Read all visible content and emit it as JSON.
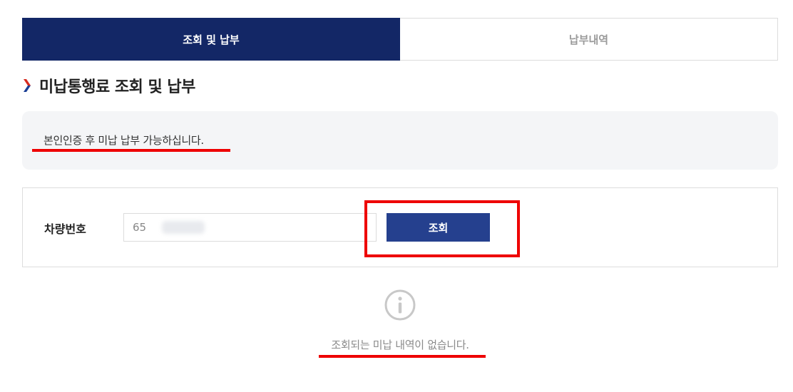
{
  "tabs": [
    {
      "label": "조회 및 납부",
      "active": true
    },
    {
      "label": "납부내역",
      "active": false
    }
  ],
  "section": {
    "title": "미납통행료 조회 및 납부",
    "chevron_icon": "chevron-right-icon"
  },
  "notice": {
    "text": "본인인증 후 미납 납부 가능하십니다."
  },
  "search": {
    "label": "차량번호",
    "input_value": "65",
    "button_label": "조회"
  },
  "empty_state": {
    "icon": "info-icon",
    "message": "조회되는 미납 내역이 없습니다."
  },
  "colors": {
    "active_tab": "#132766",
    "button": "#25408e",
    "annotation": "#ee0000",
    "chevron_top": "#d62b1f",
    "chevron_bottom": "#1b3f95"
  }
}
